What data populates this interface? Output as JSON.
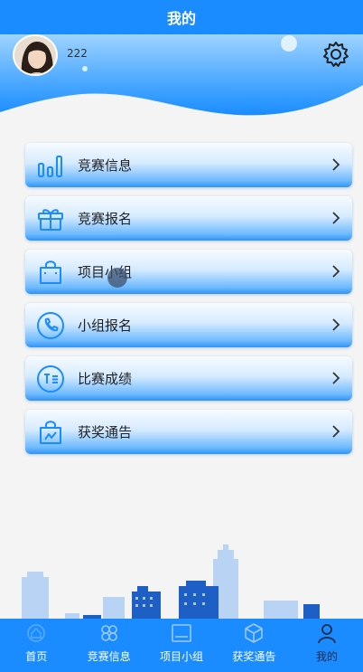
{
  "page": {
    "title": "我的"
  },
  "profile": {
    "username": "222"
  },
  "menu": [
    {
      "label": "竞赛信息",
      "icon": "bar-chart-icon"
    },
    {
      "label": "竞赛报名",
      "icon": "gift-icon"
    },
    {
      "label": "项目小组",
      "icon": "shopping-bag-icon"
    },
    {
      "label": "小组报名",
      "icon": "phone-icon"
    },
    {
      "label": "比赛成绩",
      "icon": "text-badge-icon"
    },
    {
      "label": "获奖通告",
      "icon": "trend-bag-icon"
    }
  ],
  "tabs": [
    {
      "label": "首页",
      "icon": "home-icon",
      "active": false
    },
    {
      "label": "竞赛信息",
      "icon": "clover-icon",
      "active": false
    },
    {
      "label": "项目小组",
      "icon": "image-frame-icon",
      "active": false
    },
    {
      "label": "获奖通告",
      "icon": "box-icon",
      "active": false
    },
    {
      "label": "我的",
      "icon": "user-icon",
      "active": true
    }
  ],
  "colors": {
    "primary": "#1a8cff",
    "header_light": "#bfe2ff",
    "menu_accent": "#2f95f2",
    "active_tab_text": "#1b2a4a"
  }
}
